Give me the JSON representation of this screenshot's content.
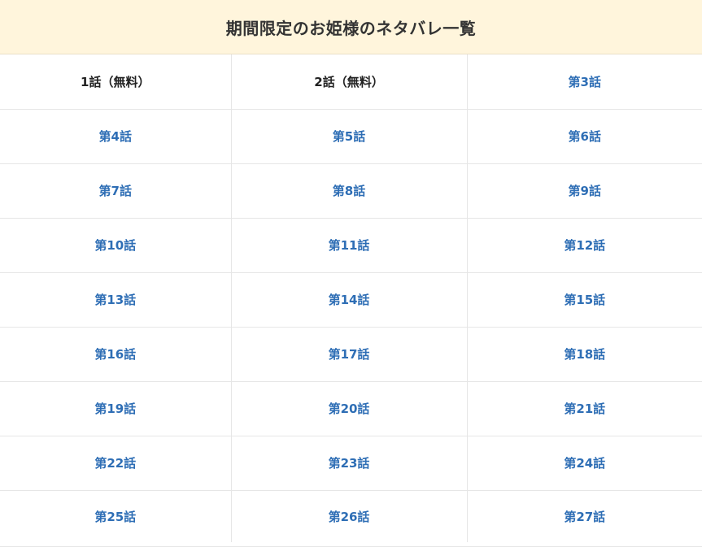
{
  "title": "期間限定のお姫様のネタバレ一覧",
  "colors": {
    "title_background": "#fff5dc",
    "link": "#2e6eb5",
    "free_text": "#222222",
    "border": "#e6e6e6"
  },
  "episodes": [
    {
      "label": "1話（無料）",
      "free": true
    },
    {
      "label": "2話（無料）",
      "free": true
    },
    {
      "label": "第3話",
      "free": false
    },
    {
      "label": "第4話",
      "free": false
    },
    {
      "label": "第5話",
      "free": false
    },
    {
      "label": "第6話",
      "free": false
    },
    {
      "label": "第7話",
      "free": false
    },
    {
      "label": "第8話",
      "free": false
    },
    {
      "label": "第9話",
      "free": false
    },
    {
      "label": "第10話",
      "free": false
    },
    {
      "label": "第11話",
      "free": false
    },
    {
      "label": "第12話",
      "free": false
    },
    {
      "label": "第13話",
      "free": false
    },
    {
      "label": "第14話",
      "free": false
    },
    {
      "label": "第15話",
      "free": false
    },
    {
      "label": "第16話",
      "free": false
    },
    {
      "label": "第17話",
      "free": false
    },
    {
      "label": "第18話",
      "free": false
    },
    {
      "label": "第19話",
      "free": false
    },
    {
      "label": "第20話",
      "free": false
    },
    {
      "label": "第21話",
      "free": false
    },
    {
      "label": "第22話",
      "free": false
    },
    {
      "label": "第23話",
      "free": false
    },
    {
      "label": "第24話",
      "free": false
    },
    {
      "label": "第25話",
      "free": false
    },
    {
      "label": "第26話",
      "free": false
    },
    {
      "label": "第27話",
      "free": false
    }
  ]
}
